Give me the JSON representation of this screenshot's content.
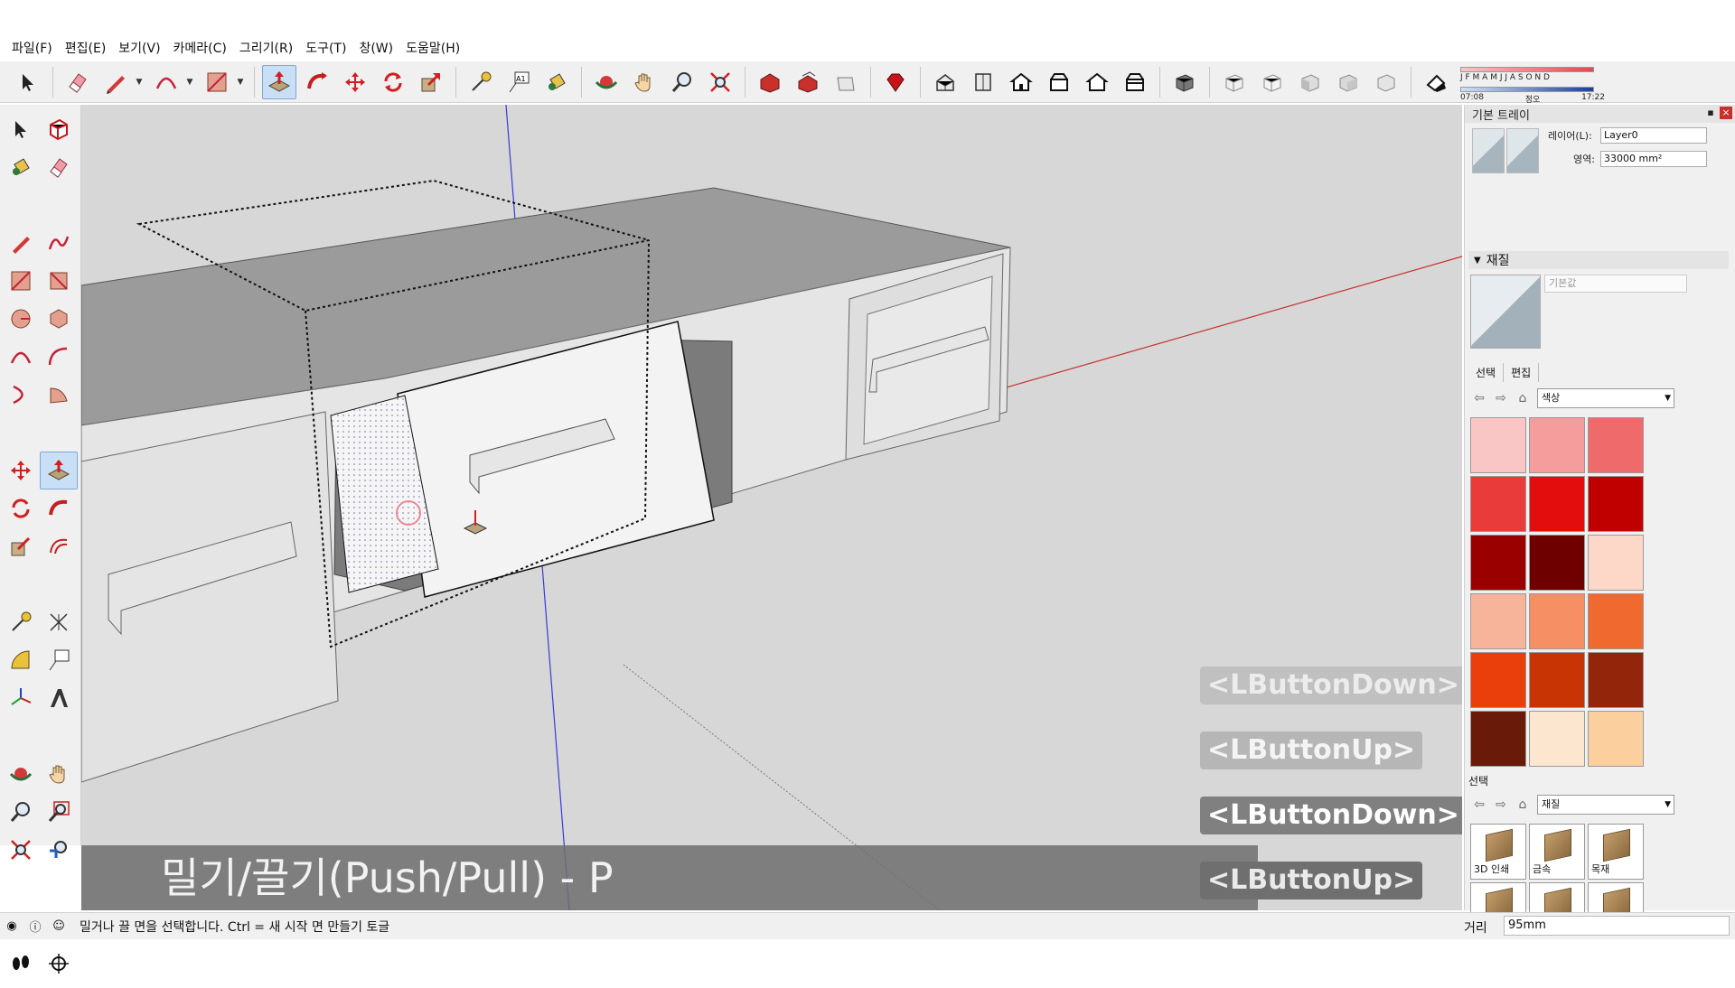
{
  "menu": [
    "파일(F)",
    "편집(E)",
    "보기(V)",
    "카메라(C)",
    "그리기(R)",
    "도구(T)",
    "창(W)",
    "도움말(H)"
  ],
  "shadow": {
    "months": "J F M A M J J A S O N D",
    "time_start": "07:08",
    "time_noon": "정오",
    "time_end": "17:22"
  },
  "tray": {
    "title": "기본 트레이",
    "entity": {
      "layer_label": "레이어(L):",
      "layer_value": "Layer0",
      "area_label": "영역:",
      "area_value": "33000 mm²"
    },
    "materials": {
      "header": "재질",
      "name_placeholder": "기본값",
      "tabs": [
        "선택",
        "편집"
      ],
      "collection": "색상",
      "swatches": [
        "#f9c5c5",
        "#f59c9c",
        "#ef6a6a",
        "#ea3b3b",
        "#e40d0d",
        "#c00000",
        "#9a0000",
        "#6e0000",
        "#fdd7c7",
        "#f8b49b",
        "#f68f63",
        "#f06a30",
        "#ea3f0a",
        "#c93405",
        "#93260a",
        "#6a1a08",
        "#fde6cf",
        "#fccf9f"
      ],
      "lib_label": "선택",
      "lib_collection": "재질",
      "lib_items": [
        "3D 인쇄",
        "금속",
        "목재",
        "",
        "",
        ""
      ]
    }
  },
  "viewport": {
    "caption": "밀기/끌기(Push/Pull) - P",
    "keys": [
      "<LButtonDown>",
      "<LButtonUp>",
      "<LButtonDown>",
      "<LButtonUp>"
    ]
  },
  "status": {
    "text": "밀거나 끌 면을 선택합니다. Ctrl = 새 시작 면 만들기 토글",
    "dist_label": "거리",
    "dist_value": "95mm"
  }
}
